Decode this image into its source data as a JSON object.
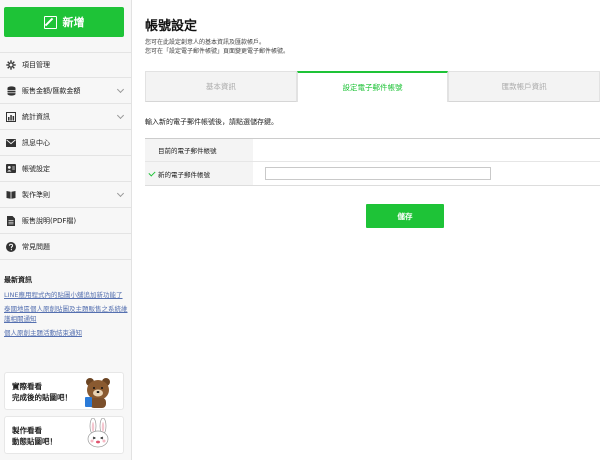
{
  "sidebar": {
    "new_button": "新增",
    "items": [
      {
        "label": "項目管理",
        "icon": "gear-icon",
        "has_chevron": false
      },
      {
        "label": "販售金額/匯款金額",
        "icon": "database-icon",
        "has_chevron": true
      },
      {
        "label": "統計資訊",
        "icon": "bar-chart-icon",
        "has_chevron": true
      },
      {
        "label": "訊息中心",
        "icon": "envelope-icon",
        "has_chevron": false
      },
      {
        "label": "帳號設定",
        "icon": "user-card-icon",
        "has_chevron": false
      },
      {
        "label": "製作準則",
        "icon": "book-icon",
        "has_chevron": true
      },
      {
        "label": "販售說明(PDF檔)",
        "icon": "document-icon",
        "has_chevron": false
      },
      {
        "label": "常見問題",
        "icon": "question-icon",
        "has_chevron": false
      }
    ],
    "news": {
      "title": "最新資訊",
      "links": [
        "LINE應用程式內的貼圖小舖追加新功能了",
        "泰國地區個人原創貼圖及主題販售之系統維護相關通知",
        "個人原創主題活動結束通知"
      ]
    },
    "promos": [
      {
        "line1": "實際看看",
        "line2": "完成後的貼圖吧！",
        "character": "brown-bear"
      },
      {
        "line1": "製作看看",
        "line2": "動態貼圖吧！",
        "character": "cony-rabbit"
      }
    ]
  },
  "main": {
    "title": "帳號設定",
    "desc_line1": "您可在此設定創意人的基本資訊及匯款帳戶。",
    "desc_line2": "您可在「設定電子郵件帳號」頁面變更電子郵件帳號。",
    "tabs": [
      {
        "label": "基本資訊",
        "active": false
      },
      {
        "label": "設定電子郵件帳號",
        "active": true
      },
      {
        "label": "匯款帳戶資訊",
        "active": false
      }
    ],
    "instruction": "輸入新的電子郵件帳號後，請點選儲存鍵。",
    "form": {
      "current_label": "目前的電子郵件帳號",
      "current_value": "",
      "new_label": "新的電子郵件帳號",
      "new_value": "",
      "new_placeholder": ""
    },
    "save_button": "儲存"
  },
  "colors": {
    "accent": "#1ec337",
    "sidebar_bg": "#f7f7f7",
    "link": "#5570b0"
  }
}
